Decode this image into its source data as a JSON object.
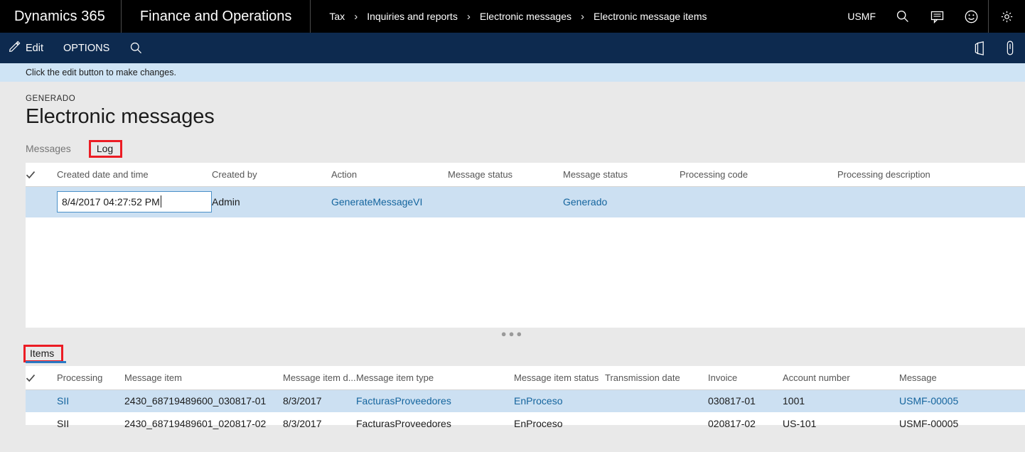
{
  "topbar": {
    "brand": "Dynamics 365",
    "module": "Finance and Operations",
    "breadcrumb": [
      "Tax",
      "Inquiries and reports",
      "Electronic messages",
      "Electronic message items"
    ],
    "separator": "›",
    "company": "USMF",
    "icons": [
      "search-icon",
      "feedback-icon",
      "smiley-icon",
      "settings-gear-icon"
    ]
  },
  "commandbar": {
    "edit_label": "Edit",
    "options_label": "OPTIONS",
    "search_icon": "search-icon",
    "right_icons": [
      "office-apps-icon",
      "attachment-icon"
    ]
  },
  "messagebar": {
    "text": "Click the edit button to make changes."
  },
  "header": {
    "caption": "GENERADO",
    "title": "Electronic messages"
  },
  "tabs": {
    "messages": "Messages",
    "log": "Log"
  },
  "log_grid": {
    "columns": [
      "Created date and time",
      "Created by",
      "Action",
      "Message status",
      "Message status",
      "Processing code",
      "Processing description"
    ],
    "rows": [
      {
        "created_date": "8/4/2017 04:27:52 PM",
        "created_by": "Admin",
        "action": "GenerateMessageVI",
        "message_status_1": "",
        "message_status_2": "Generado",
        "processing_code": "",
        "processing_description": "",
        "selected": true,
        "editing": true
      }
    ]
  },
  "items_section": {
    "tab_label": "Items"
  },
  "items_grid": {
    "columns": [
      "Processing",
      "Message item",
      "Message item d...",
      "Message item type",
      "Message item status",
      "Transmission date",
      "Invoice",
      "Account number",
      "Message"
    ],
    "rows": [
      {
        "processing": "SII",
        "message_item": "2430_68719489600_030817-01",
        "message_item_date": "8/3/2017",
        "message_item_type": "FacturasProveedores",
        "message_item_status": "EnProceso",
        "transmission_date": "",
        "invoice": "030817-01",
        "account_number": "1001",
        "message": "USMF-00005",
        "selected": true
      },
      {
        "processing": "SII",
        "message_item": "2430_68719489601_020817-02",
        "message_item_date": "8/3/2017",
        "message_item_type": "FacturasProveedores",
        "message_item_status": "EnProceso",
        "transmission_date": "",
        "invoice": "020817-02",
        "account_number": "US-101",
        "message": "USMF-00005",
        "selected": false
      }
    ]
  },
  "splitter": {
    "dots": "⠇"
  },
  "colors": {
    "topbar_bg": "#000000",
    "commandbar_bg": "#0d2a4f",
    "messagebar_bg": "#cfe4f5",
    "page_bg": "#e9e9e9",
    "link": "#15659e",
    "selection": "#cce0f2",
    "annotation": "#ec1c24",
    "tab_active_underline": "#2a7ac4"
  }
}
